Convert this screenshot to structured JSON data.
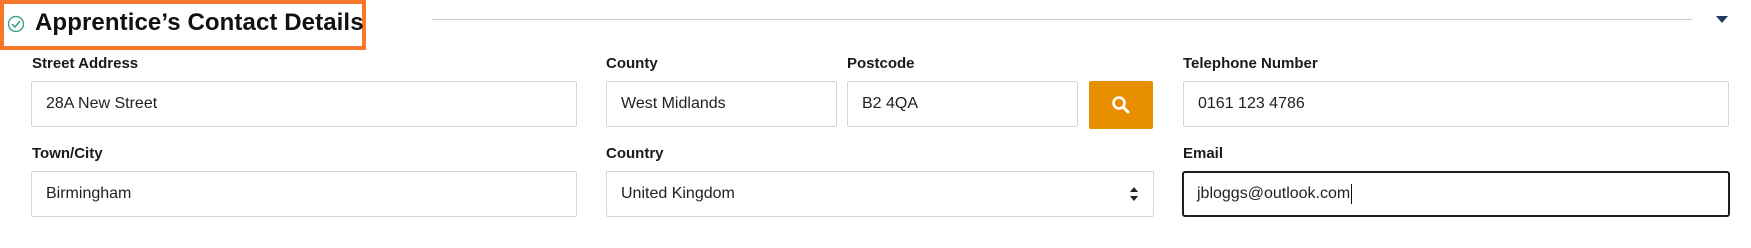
{
  "section": {
    "title": "Apprentice’s Contact Details"
  },
  "fields": {
    "street_address": {
      "label": "Street Address",
      "value": "28A New Street"
    },
    "county": {
      "label": "County",
      "value": "West Midlands"
    },
    "postcode": {
      "label": "Postcode",
      "value": "B2 4QA"
    },
    "telephone": {
      "label": "Telephone Number",
      "value": "0161 123 4786"
    },
    "town_city": {
      "label": "Town/City",
      "value": "Birmingham"
    },
    "country": {
      "label": "Country",
      "value": "United Kingdom"
    },
    "email": {
      "label": "Email",
      "value": "jbloggs@outlook.com"
    }
  },
  "colors": {
    "highlight_border": "#f7782a",
    "search_button": "#e88f00",
    "collapse_arrow": "#1e3a5f",
    "check_icon": "#3aa08a"
  },
  "icons": {
    "status": "check-circle-icon",
    "collapse": "caret-down-icon",
    "search": "search-icon",
    "select": "select-arrows-icon"
  }
}
